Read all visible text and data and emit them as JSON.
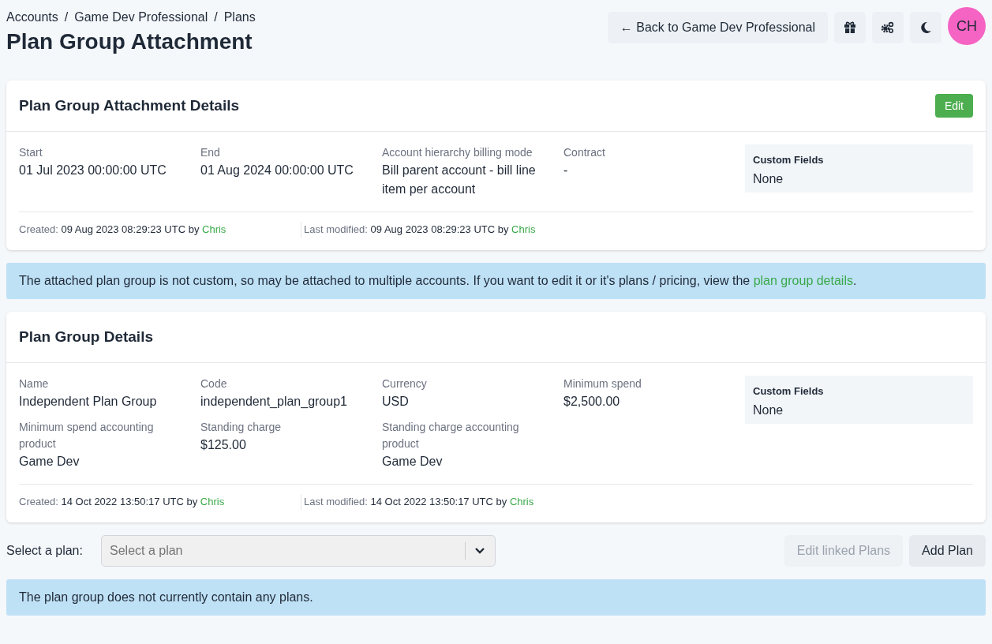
{
  "breadcrumb": {
    "items": [
      "Accounts",
      "Game Dev Professional",
      "Plans"
    ],
    "separator": "/"
  },
  "title": "Plan Group Attachment",
  "header_actions": {
    "back_button": "← Back to Game Dev Professional",
    "avatar": "CH"
  },
  "cards": [
    {
      "title": "Plan Group Attachment Details",
      "edit_button": "Edit",
      "fields": [
        {
          "label": "Start",
          "value": "01 Jul 2023 00:00:00 UTC"
        },
        {
          "label": "End",
          "value": "01 Aug 2024 00:00:00 UTC"
        },
        {
          "label": "Account hierarchy billing mode",
          "value": "Bill parent account - bill line item per account"
        },
        {
          "label": "Contract",
          "value": "-"
        }
      ],
      "custom_fields": {
        "title": "Custom Fields",
        "value": "None"
      },
      "meta": [
        {
          "label": "Created:",
          "value": "09 Aug 2023 08:29:23 UTC",
          "by": "by",
          "user": "Chris"
        },
        {
          "label": "Last modified:",
          "value": "09 Aug 2023 08:29:23 UTC",
          "by": "by",
          "user": "Chris"
        }
      ]
    },
    {
      "title": "Plan Group Details",
      "fields": [
        {
          "label": "Name",
          "value": "Independent Plan Group"
        },
        {
          "label": "Code",
          "value": "independent_plan_group1"
        },
        {
          "label": "Currency",
          "value": "USD"
        },
        {
          "label": "Minimum spend",
          "value": "$2,500.00"
        },
        {
          "label": "Minimum spend accounting product",
          "value": "Game Dev"
        },
        {
          "label": "Standing charge",
          "value": "$125.00"
        },
        {
          "label": "Standing charge accounting product",
          "value": "Game Dev"
        }
      ],
      "custom_fields": {
        "title": "Custom Fields",
        "value": "None"
      },
      "meta": [
        {
          "label": "Created:",
          "value": "14 Oct 2022 13:50:17 UTC",
          "by": "by",
          "user": "Chris"
        },
        {
          "label": "Last modified:",
          "value": "14 Oct 2022 13:50:17 UTC",
          "by": "by",
          "user": "Chris"
        }
      ]
    }
  ],
  "notice": {
    "text": "The attached plan group is not custom, so may be attached to multiple accounts. If you want to edit it or it's plans / pricing, view the",
    "link": "plan group details",
    "end": "."
  },
  "plan_select": {
    "label": "Select a plan:",
    "placeholder": "Select a plan",
    "disabled": true
  },
  "plan_buttons": [
    {
      "label": "Edit linked Plans",
      "disabled": true
    },
    {
      "label": "Add Plan",
      "disabled": false
    }
  ],
  "empty_notice": "The plan group does not currently contain any plans."
}
